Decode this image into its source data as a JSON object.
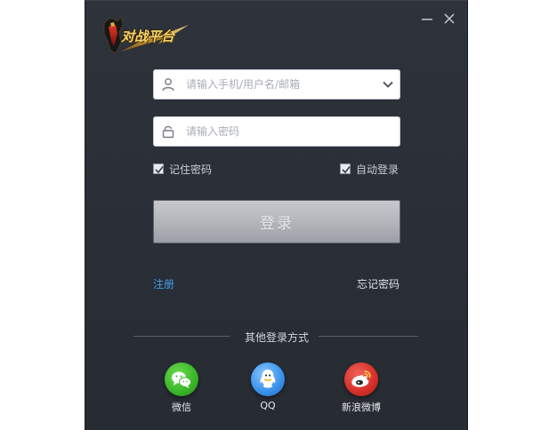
{
  "app": {
    "logo_icon": "logo-icon",
    "logo_text": "对战平台",
    "minimize_icon": "minimize-icon",
    "close_icon": "close-icon"
  },
  "login": {
    "username_placeholder": "请输入手机/用户名/邮箱",
    "username_value": "",
    "password_placeholder": "请输入密码",
    "password_value": "",
    "user_icon": "user-icon",
    "lock_icon": "lock-icon",
    "dropdown_icon": "chevron-down-icon",
    "remember_label": "记住密码",
    "remember_checked": true,
    "auto_login_label": "自动登录",
    "auto_login_checked": true,
    "submit_label": "登录"
  },
  "links": {
    "register": "注册",
    "forgot": "忘记密码"
  },
  "other": {
    "title": "其他登录方式",
    "providers": [
      {
        "label": "微信",
        "icon": "wechat-icon",
        "color": "#3cb82a"
      },
      {
        "label": "QQ",
        "icon": "qq-icon",
        "color": "#3d95ec"
      },
      {
        "label": "新浪微博",
        "icon": "weibo-icon",
        "color": "#d8322b"
      }
    ]
  },
  "colors": {
    "window_bg": "#2c3038",
    "link": "#3fa0e6",
    "button": "#b5b8bd"
  }
}
